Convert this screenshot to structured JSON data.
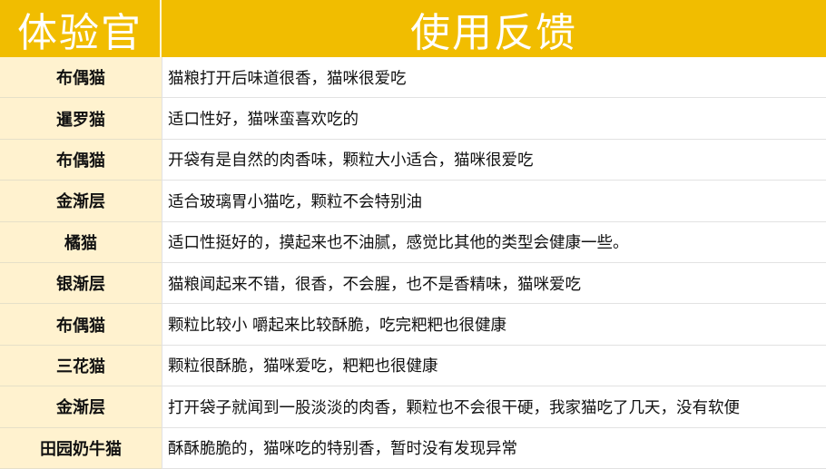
{
  "header": {
    "col_reviewer": "体验官",
    "col_feedback": "使用反馈"
  },
  "rows": [
    {
      "name": "布偶猫",
      "feedback": "猫粮打开后味道很香，猫咪很爱吃"
    },
    {
      "name": "暹罗猫",
      "feedback": "适口性好，猫咪蛮喜欢吃的"
    },
    {
      "name": "布偶猫",
      "feedback": "开袋有是自然的肉香味，颗粒大小适合，猫咪很爱吃"
    },
    {
      "name": "金渐层",
      "feedback": "适合玻璃胃小猫吃，颗粒不会特别油"
    },
    {
      "name": "橘猫",
      "feedback": "适口性挺好的，摸起来也不油腻，感觉比其他的类型会健康一些。"
    },
    {
      "name": "银渐层",
      "feedback": "猫粮闻起来不错，很香，不会腥，也不是香精味，猫咪爱吃"
    },
    {
      "name": "布偶猫",
      "feedback": "颗粒比较小 嚼起来比较酥脆，吃完粑粑也很健康"
    },
    {
      "name": "三花猫",
      "feedback": "颗粒很酥脆，猫咪爱吃，粑粑也很健康"
    },
    {
      "name": "金渐层",
      "feedback": "打开袋子就闻到一股淡淡的肉香，颗粒也不会很干硬，我家猫吃了几天，没有软便"
    },
    {
      "name": "田园奶牛猫",
      "feedback": "酥酥脆脆的，猫咪吃的特别香，暂时没有发现异常"
    }
  ]
}
